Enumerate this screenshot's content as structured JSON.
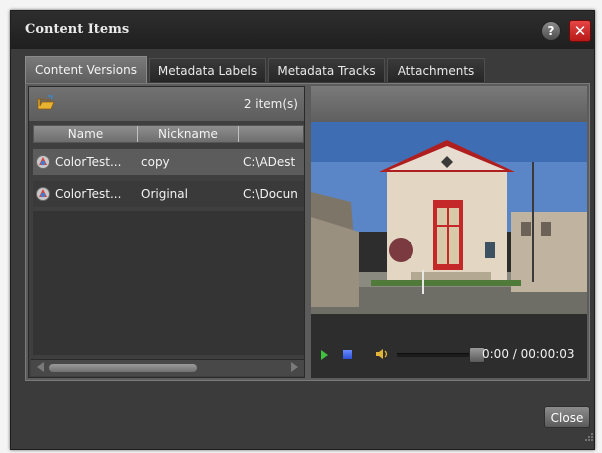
{
  "window": {
    "title": "Content Items",
    "help_label": "?",
    "close_label": "✕"
  },
  "tabs": [
    {
      "label": "Content Versions",
      "active": true
    },
    {
      "label": "Metadata Labels",
      "active": false
    },
    {
      "label": "Metadata Tracks",
      "active": false
    },
    {
      "label": "Attachments",
      "active": false
    }
  ],
  "list": {
    "item_count": "2 item(s)",
    "columns": [
      "Name",
      "Nickname",
      ""
    ],
    "rows": [
      {
        "name": "ColorTest...",
        "nickname": "copy",
        "path": "C:\\ADest",
        "selected": true
      },
      {
        "name": "ColorTest...",
        "nickname": "Original",
        "path": "C:\\Docun",
        "selected": false
      }
    ]
  },
  "player": {
    "time_display": "0:00 / 00:00:03",
    "position_fraction": 0.0
  },
  "footer": {
    "close_button": "Close"
  },
  "colors": {
    "close_red": "#d32020",
    "play_green": "#3fc23f",
    "stop_blue": "#2b4fd8",
    "dialog_bg": "#3b3b3b"
  },
  "icons": [
    "help-icon",
    "close-icon",
    "folder-open-icon",
    "file-icon",
    "play-icon",
    "stop-icon",
    "volume-icon",
    "resize-grip-icon"
  ]
}
